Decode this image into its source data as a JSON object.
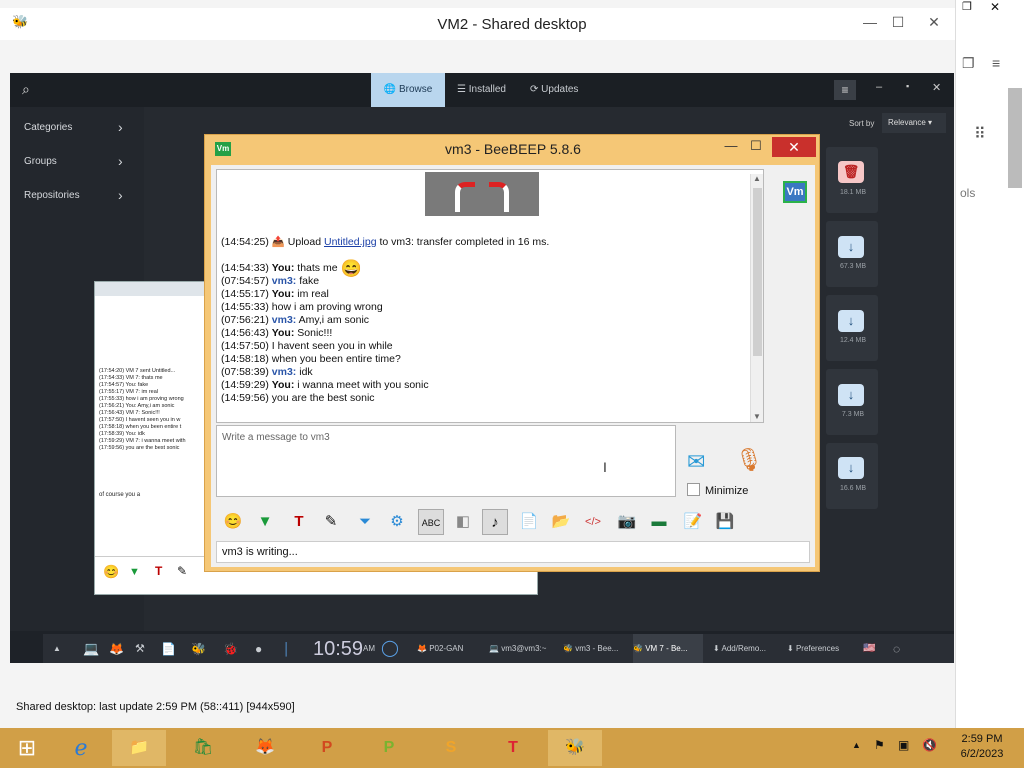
{
  "vm2": {
    "title": "VM2 - Shared desktop",
    "status": "Shared desktop: last update 2:59 PM (58::411) [944x590]"
  },
  "software_center": {
    "tabs": [
      "Browse",
      "Installed",
      "Updates"
    ],
    "categories": [
      "Categories",
      "Groups",
      "Repositories"
    ],
    "sort_label": "Sort by",
    "sort_value": "Relevance",
    "sizes": [
      "18.1 MB",
      "67.3 MB",
      "12.4 MB",
      "7.3 MB",
      "16.6 MB"
    ]
  },
  "remote_taskbar": {
    "clock": "10:59",
    "clock_suffix": "AM",
    "items": [
      "P02-GAN",
      "vm3@vm3:~",
      "vm3 - Bee...",
      "VM 7 - Be...",
      "Add/Remo...",
      "Preferences"
    ]
  },
  "vm7_chat": {
    "messages": [
      "(17:54:20) VM 7 sent Untitled...",
      "(17:54:33) VM 7: thats me",
      "(17:54:57) You: fake",
      "(17:55:17) VM 7: im real",
      "(17:55:33)    how i am proving wrong",
      "(17:56:21) You: Amy,i am sonic",
      "(17:56:43) VM 7: Sonic!!!",
      "(17:57:50)    I havent seen you in w",
      "(17:58:18)    when you been entire t",
      "(17:58:39) You: idk",
      "(17:59:29) VM 7: i wanna meet with",
      "(17:59:56)    you are the best sonic"
    ],
    "draft": "of course you a"
  },
  "beebeep": {
    "title": "vm3 - BeeBEEP 5.8.6",
    "logo": "Vm",
    "upload_time": "(14:54:25)",
    "upload_prefix": "Upload",
    "upload_file": "Untitled.jpg",
    "upload_suffix": "to vm3: transfer completed in 16 ms.",
    "messages": [
      {
        "time": "(14:54:33)",
        "who": "You:",
        "peer": "",
        "text": "thats me"
      },
      {
        "time": "(07:54:57)",
        "who": "",
        "peer": "vm3:",
        "text": "fake"
      },
      {
        "time": "(14:55:17)",
        "who": "You:",
        "peer": "",
        "text": "im real"
      },
      {
        "time": "(14:55:33)",
        "who": "",
        "peer": "",
        "text": "how i am proving wrong"
      },
      {
        "time": "(07:56:21)",
        "who": "",
        "peer": "vm3:",
        "text": "Amy,i am sonic"
      },
      {
        "time": "(14:56:43)",
        "who": "You:",
        "peer": "",
        "text": "Sonic!!!"
      },
      {
        "time": "(14:57:50)",
        "who": "",
        "peer": "",
        "text": "I havent seen you in while"
      },
      {
        "time": "(14:58:18)",
        "who": "",
        "peer": "",
        "text": "when you been entire time?"
      },
      {
        "time": "(07:58:39)",
        "who": "",
        "peer": "vm3:",
        "text": "idk"
      },
      {
        "time": "(14:59:29)",
        "who": "You:",
        "peer": "",
        "text": "i wanna meet with you sonic"
      },
      {
        "time": "(14:59:56)",
        "who": "",
        "peer": "",
        "text": "you are the best sonic"
      }
    ],
    "input_placeholder": "Write a message to vm3",
    "minimize_label": "Minimize",
    "status": "vm3 is writing...",
    "user_badge": "Vm"
  },
  "taskbar": {
    "time": "2:59 PM",
    "date": "6/2/2023"
  },
  "colors": {
    "beebeep_frame": "#f5c776",
    "taskbar": "#d19f47",
    "close": "#c9302c",
    "browse_tab": "#b9d6ee"
  }
}
